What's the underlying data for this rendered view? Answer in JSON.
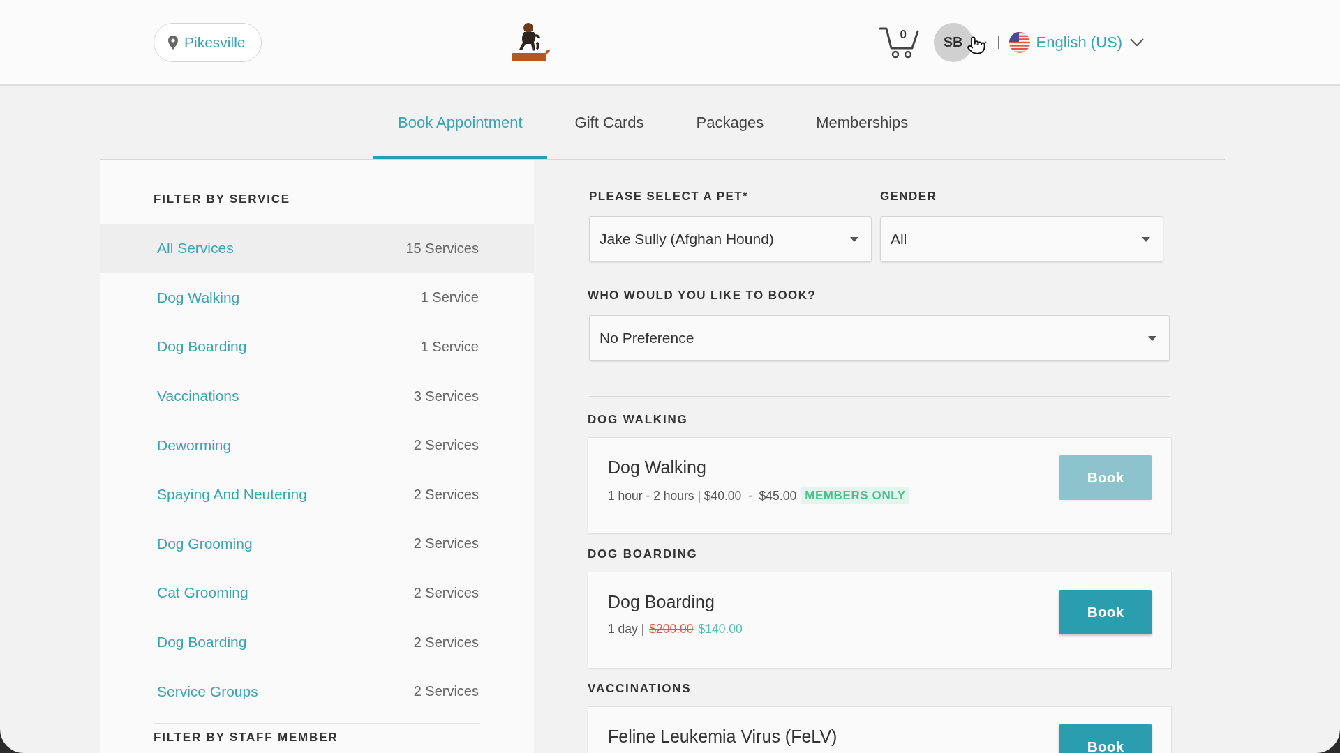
{
  "header": {
    "location": "Pikesville",
    "cart_count": "0",
    "avatar": "SB",
    "language": "English (US)"
  },
  "tabs": [
    {
      "label": "Book Appointment",
      "selected": true
    },
    {
      "label": "Gift Cards",
      "selected": false
    },
    {
      "label": "Packages",
      "selected": false
    },
    {
      "label": "Memberships",
      "selected": false
    }
  ],
  "sidebar": {
    "title": "FILTER BY SERVICE",
    "items": [
      {
        "label": "All Services",
        "count": "15 Services",
        "selected": true
      },
      {
        "label": "Dog Walking",
        "count": "1 Service",
        "selected": false
      },
      {
        "label": "Dog Boarding",
        "count": "1 Service",
        "selected": false
      },
      {
        "label": "Vaccinations",
        "count": "3 Services",
        "selected": false
      },
      {
        "label": "Deworming",
        "count": "2 Services",
        "selected": false
      },
      {
        "label": "Spaying And Neutering",
        "count": "2 Services",
        "selected": false
      },
      {
        "label": "Dog Grooming",
        "count": "2 Services",
        "selected": false
      },
      {
        "label": "Cat Grooming",
        "count": "2 Services",
        "selected": false
      },
      {
        "label": "Dog Boarding",
        "count": "2 Services",
        "selected": false
      },
      {
        "label": "Service Groups",
        "count": "2 Services",
        "selected": false
      }
    ],
    "next_title": "FILTER BY STAFF MEMBER"
  },
  "booking": {
    "fields": [
      {
        "label": "PLEASE SELECT A PET*",
        "value": "Jake Sully (Afghan Hound)"
      },
      {
        "label": "GENDER",
        "value": "All"
      }
    ],
    "staff_field": {
      "label": "WHO WOULD YOU LIKE TO BOOK?",
      "value": "No Preference"
    }
  },
  "sections": [
    {
      "title": "DOG WALKING",
      "services": [
        {
          "name": "Dog Walking",
          "details": "1 hour - 2 hours | $40.00  -  $45.00",
          "badge": "MEMBERS ONLY",
          "button": "Book",
          "disabled": true
        }
      ]
    },
    {
      "title": "DOG BOARDING",
      "services": [
        {
          "name": "Dog Boarding",
          "details": "1 day |",
          "old_price": "$200.00",
          "price": "$140.00",
          "button": "Book",
          "disabled": false
        }
      ]
    },
    {
      "title": "VACCINATIONS",
      "services": [
        {
          "name": "Feline Leukemia Virus (FeLV)",
          "button": "Book",
          "disabled": false
        }
      ]
    }
  ]
}
